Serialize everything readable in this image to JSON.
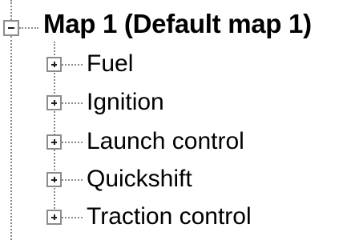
{
  "tree": {
    "root": {
      "label": "Map 1 (Default map 1)",
      "expanded": true,
      "expander_icon": "minus-box"
    },
    "children": [
      {
        "label": "Fuel",
        "expanded": false,
        "expander_icon": "plus-box"
      },
      {
        "label": "Ignition",
        "expanded": false,
        "expander_icon": "plus-box"
      },
      {
        "label": "Launch control",
        "expanded": false,
        "expander_icon": "plus-box"
      },
      {
        "label": "Quickshift",
        "expanded": false,
        "expander_icon": "plus-box"
      },
      {
        "label": "Traction control",
        "expanded": false,
        "expander_icon": "plus-box"
      }
    ],
    "colors": {
      "text": "#000000",
      "lines": "#8c8c8c",
      "background": "#ffffff"
    }
  }
}
